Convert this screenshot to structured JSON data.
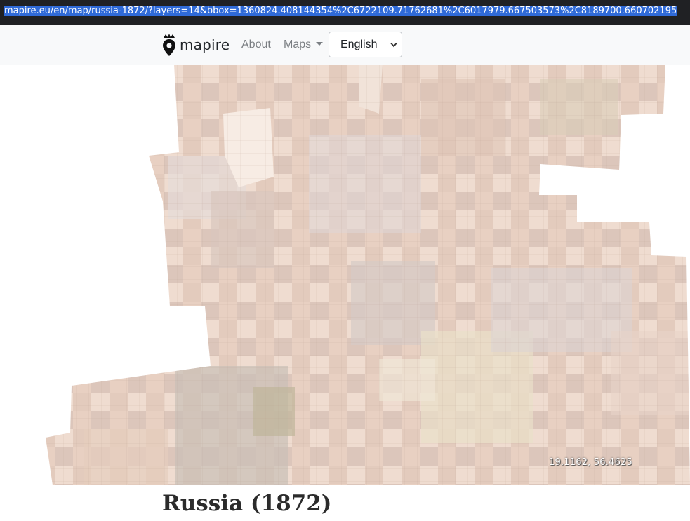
{
  "browser": {
    "url": "mapire.eu/en/map/russia-1872/?layers=14&bbox=1360824.408144354%2C6722109.71762681%2C6017979.667503573%2C8189700.660702195"
  },
  "navbar": {
    "brand": "mapire",
    "about_label": "About",
    "maps_label": "Maps",
    "language_selected": "English"
  },
  "map": {
    "coordinates_readout": "19.1162, 56.4625"
  },
  "page": {
    "title": "Russia (1872)"
  },
  "colors": {
    "navbar_bg": "#f8f9fa",
    "map_tile_base": "#e8d2c4",
    "url_selection": "#2f6ad8"
  }
}
